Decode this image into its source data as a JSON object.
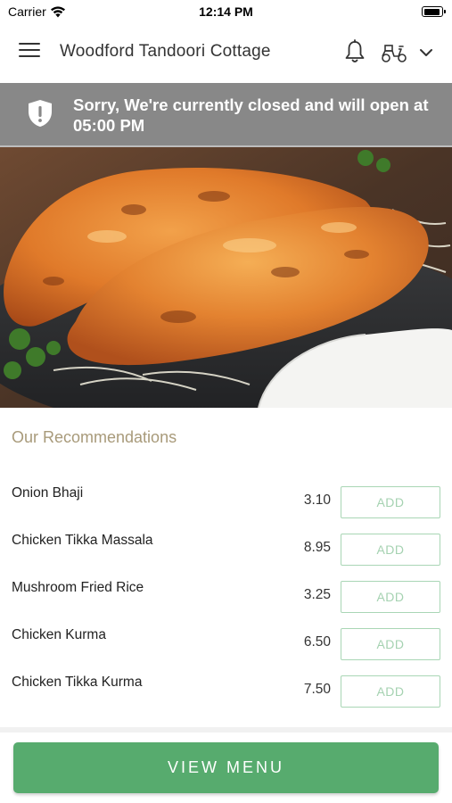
{
  "status_bar": {
    "carrier": "Carrier",
    "time": "12:14 PM"
  },
  "header": {
    "title": "Woodford Tandoori Cottage",
    "icons": [
      "hamburger-menu-icon",
      "bell-icon",
      "scooter-icon",
      "chevron-down-icon"
    ]
  },
  "banner": {
    "message": "Sorry, We're currently closed and will open at 05:00 PM",
    "icon": "shield-alert-icon",
    "background": "#888888"
  },
  "hero": {
    "image": "tandoori-chicken-photo"
  },
  "recommendations": {
    "title": "Our Recommendations",
    "items": [
      {
        "name": "Onion Bhaji",
        "price": "3.10",
        "action": "ADD"
      },
      {
        "name": "Chicken Tikka Massala",
        "price": "8.95",
        "action": "ADD"
      },
      {
        "name": "Mushroom Fried Rice",
        "price": "3.25",
        "action": "ADD"
      },
      {
        "name": "Chicken Kurma",
        "price": "6.50",
        "action": "ADD"
      },
      {
        "name": "Chicken Tikka Kurma",
        "price": "7.50",
        "action": "ADD"
      }
    ]
  },
  "footer": {
    "button_label": "VIEW MENU",
    "button_color": "#57ab6e"
  },
  "colors": {
    "accent": "#57ab6e",
    "section_title": "#a89a7a",
    "add_button_border": "#a9d6b5"
  }
}
